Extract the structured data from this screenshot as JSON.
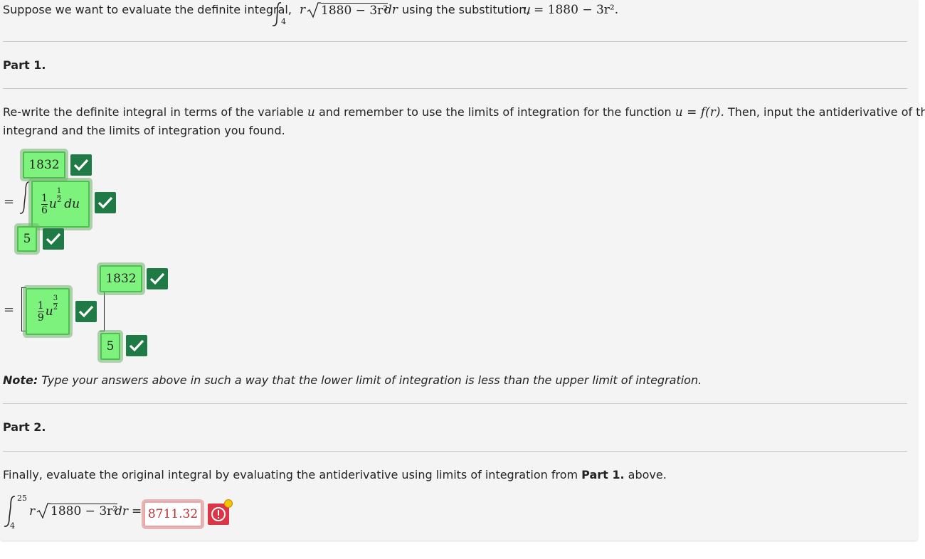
{
  "intro": {
    "text_before": "Suppose we want to evaluate the definite integral,",
    "integral_lower": "4",
    "integrand_var": "r",
    "integrand_radicand": "1880 − 3r²",
    "differential": "dr",
    "text_middle": "using the substitution,",
    "substitution": "u = 1880 − 3r².",
    "substitution_lhs": "u",
    "substitution_rhs": "= 1880 − 3r²."
  },
  "part1": {
    "heading": "Part 1.",
    "instruction_a": "Re-write the definite integral in terms of the variable",
    "instruction_var": "u",
    "instruction_b": "and remember to use the limits of integration for the function",
    "instruction_fn": "u = f(r).",
    "instruction_c": "Then, input the antiderivative of the",
    "instruction_line2": "integrand and the limits of integration you found.",
    "equals": "=",
    "upper_limit": "1832",
    "lower_limit": "5",
    "integrand_coeff_num": "1",
    "integrand_coeff_den": "6",
    "integrand_var": "u",
    "integrand_exp_num": "1",
    "integrand_exp_den": "2",
    "integrand_du": "du",
    "anti_coeff_num": "1",
    "anti_coeff_den": "9",
    "anti_var": "u",
    "anti_exp_num": "3",
    "anti_exp_den": "2",
    "eval_upper": "1832",
    "eval_lower": "5",
    "note_label": "Note:",
    "note_text": "Type your answers above in such a way that the lower limit of integration is less than the upper limit of integration."
  },
  "part2": {
    "heading": "Part 2.",
    "instruction_a": "Finally, evaluate the original integral by evaluating the antiderivative using limits of integration from",
    "instruction_bold": "Part 1.",
    "instruction_b": "above.",
    "upper": "25",
    "lower": "4",
    "integrand_var": "r",
    "radicand": "1880 − 3r²",
    "differential": "dr",
    "equals": "=",
    "answer": "8711.32"
  },
  "colors": {
    "correct_fill": "#7df27d",
    "correct_check": "#1f7a45",
    "incorrect_border": "#e9a7a7",
    "error_icon": "#dc3545",
    "warning_dot": "#f5c400"
  },
  "icons": {
    "correct": "checkmark-icon",
    "incorrect": "exclamation-circle-icon"
  }
}
